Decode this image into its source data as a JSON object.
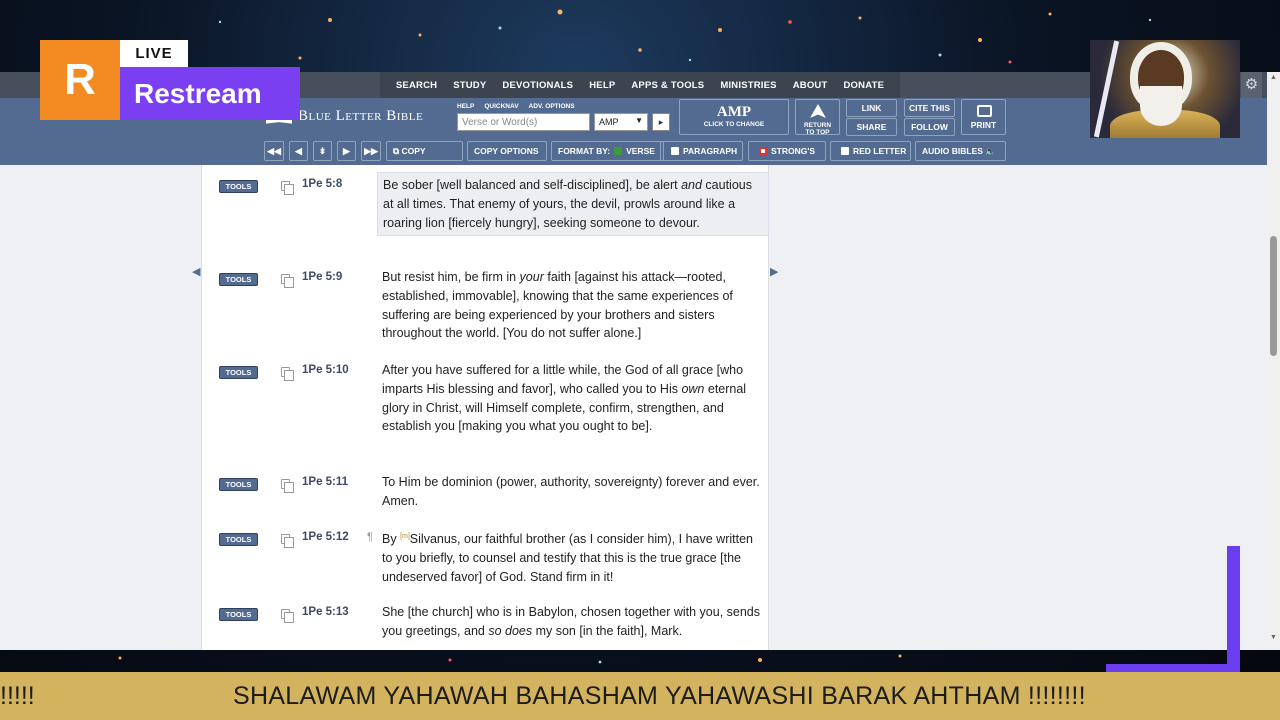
{
  "overlay": {
    "restream_logo": "R",
    "live_badge": "LIVE",
    "restream_name": "Restream",
    "ticker_text": "SHALAWAM YAHAWAH BAHASHAM YAHAWASHI BARAK AHTHAM !!!!!!!!",
    "ticker_prev": "!!!!!"
  },
  "topnav": [
    "SEARCH",
    "STUDY",
    "DEVOTIONALS",
    "HELP",
    "APPS & TOOLS",
    "MINISTRIES",
    "ABOUT",
    "DONATE"
  ],
  "toolbar": {
    "logo": "Blue Letter Bible",
    "mini_links": [
      "HELP",
      "QUICKNAV",
      "ADV. OPTIONS"
    ],
    "search_placeholder": "Verse or Word(s)",
    "version": "AMP",
    "go": "▸",
    "amp_label": "AMP",
    "amp_sub": "CLICK TO CHANGE",
    "return_to_top_1": "RETURN",
    "return_to_top_2": "TO TOP",
    "link": "LINK",
    "share": "SHARE",
    "cite_this": "CITE THIS",
    "follow": "FOLLOW",
    "print": "PRINT",
    "nav_first": "◀◀",
    "nav_prev": "◀",
    "nav_chapter": "⇟",
    "nav_next": "▶",
    "nav_last": "▶▶",
    "copy": "COPY",
    "copy_options": "COPY OPTIONS",
    "format_by": "FORMAT BY:",
    "verse": "VERSE",
    "paragraph": "PARAGRAPH",
    "strongs": "STRONG'S",
    "red_letter": "RED LETTER",
    "audio_bibles": "AUDIO BIBLES",
    "gear": "⚙"
  },
  "verses": [
    {
      "tools": "TOOLS",
      "ref": "1Pe 5:8",
      "highlight": true,
      "para": "",
      "html_parts": [
        "Be sober [well balanced and self-disciplined], be alert ",
        "and",
        " cautious at all times. That enemy of yours, the devil, prowls around like a roaring lion [fiercely hungry], seeking someone to devour."
      ]
    },
    {
      "tools": "TOOLS",
      "ref": "1Pe 5:9",
      "highlight": false,
      "para": "",
      "html_parts": [
        "But resist him, be firm in ",
        "your",
        " faith [against his attack—rooted, established, immovable], knowing that the same experiences of suffering are being experienced by your brothers and sisters throughout the world. [You do not suffer alone.]"
      ]
    },
    {
      "tools": "TOOLS",
      "ref": "1Pe 5:10",
      "highlight": false,
      "para": "",
      "html_parts": [
        "After you have suffered for a little while, the God of all grace [who imparts His blessing and favor], who called you to His ",
        "own",
        " eternal glory in Christ, will Himself complete, confirm, strengthen, and establish you [making you what you ought to be]."
      ]
    },
    {
      "tools": "TOOLS",
      "ref": "1Pe 5:11",
      "highlight": false,
      "para": "",
      "html_parts": [
        "To Him be dominion (power, authority, sovereignty) forever and ever. Amen.",
        "",
        ""
      ]
    },
    {
      "tools": "TOOLS",
      "ref": "1Pe 5:12",
      "highlight": false,
      "para": "¶",
      "footnote": "[m]",
      "html_parts": [
        "By ",
        "",
        "Silvanus, our faithful brother (as I consider him), I have written to you briefly, to counsel and testify that this is the true grace [the undeserved favor] of God. Stand firm in it!"
      ]
    },
    {
      "tools": "TOOLS",
      "ref": "1Pe 5:13",
      "highlight": false,
      "para": "",
      "html_parts": [
        "She [the church] who is in Babylon, chosen together with you, sends you greetings, and ",
        "so does",
        " my son [in the faith], Mark."
      ]
    }
  ]
}
